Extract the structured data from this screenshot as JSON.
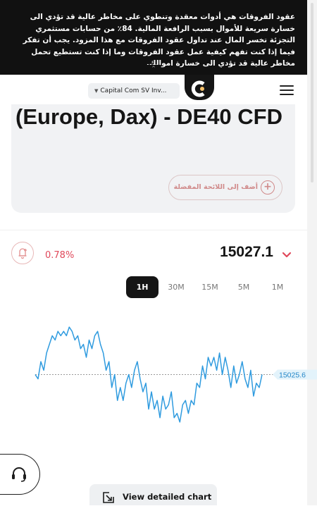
{
  "risk_warning": {
    "text": "عقود الفروقات هي أدوات معقدة وتنطوي على مخاطر عالية قد تؤدي الى خسارة سريعة للأموال بسبب الرافعة المالية. 84٪ من حسابات مستثمري التجزئة تخسر المال عند تداول عقود الفروقات مع هذا المزود. يجب أن تفكر فيما إذا كنت تفهم كيفية عمل عقود الفروقات وما إذا كنت تستطيع تحمل مخاطر عالية قد تؤدي الى خسارة اموالك.",
    "collapse_icon": "double-chevron-up-icon"
  },
  "header": {
    "broker_selector": "Capital Com SV Inv...",
    "logo_icon": "capital-com-logo",
    "menu_icon": "hamburger-menu-icon"
  },
  "instrument": {
    "title": "(Europe, Dax) - DE40 CFD",
    "favorite_label": "أضف إلى اللائحة المفضلة",
    "favorite_icon": "plus-circle-icon"
  },
  "quote": {
    "change": "0.78%",
    "price": "15027.1",
    "alert_icon": "bell-plus-icon",
    "toggle_icon": "chevron-down-icon"
  },
  "timeframes": [
    {
      "label": "1H",
      "active": true
    },
    {
      "label": "30M",
      "active": false
    },
    {
      "label": "15M",
      "active": false
    },
    {
      "label": "5M",
      "active": false
    },
    {
      "label": "1M",
      "active": false
    }
  ],
  "chart_data": {
    "type": "line",
    "x": [
      0,
      1,
      2,
      3,
      4,
      5,
      6,
      7,
      8,
      9,
      10,
      11,
      12,
      13,
      14,
      15,
      16,
      17,
      18,
      19,
      20,
      21,
      22,
      23,
      24,
      25,
      26,
      27,
      28,
      29,
      30,
      31,
      32,
      33,
      34,
      35,
      36,
      37,
      38,
      39,
      40,
      41,
      42,
      43,
      44,
      45,
      46,
      47,
      48,
      49,
      50,
      51,
      52,
      53,
      54,
      55,
      56,
      57,
      58,
      59,
      60,
      61,
      62,
      63,
      64,
      65,
      66,
      67,
      68,
      69,
      70,
      71,
      72,
      73,
      74,
      75,
      76,
      77,
      78,
      79,
      80
    ],
    "values": [
      15025.6,
      15025.5,
      15025.9,
      15025.7,
      15026.1,
      15026.3,
      15026.5,
      15026.4,
      15026.6,
      15026.5,
      15026.6,
      15026.5,
      15026.7,
      15026.6,
      15026.4,
      15026.5,
      15026.2,
      15026.3,
      15026.0,
      15026.4,
      15026.2,
      15026.5,
      15026.6,
      15026.3,
      15026.1,
      15025.7,
      15025.9,
      15025.3,
      15025.6,
      15025.0,
      15025.3,
      15025.0,
      15025.4,
      15025.6,
      15025.3,
      15025.7,
      15025.9,
      15025.5,
      15025.2,
      15025.4,
      15024.8,
      15025.2,
      15024.8,
      15025.0,
      15024.6,
      15025.1,
      15024.8,
      15024.9,
      15025.2,
      15024.6,
      15024.7,
      15024.5,
      15024.9,
      15025.0,
      15024.7,
      15025.0,
      15024.9,
      15025.4,
      15025.3,
      15025.8,
      15025.5,
      15026.0,
      15025.8,
      15026.0,
      15025.7,
      15026.1,
      15025.6,
      15026.0,
      15025.7,
      15025.3,
      15025.8,
      15025.4,
      15025.6,
      15025.9,
      15025.5,
      15025.3,
      15025.7,
      15025.1,
      15025.4,
      15025.3,
      15025.6
    ],
    "current_value": "15025.6",
    "color": "#2f9bdf"
  },
  "support": {
    "icon": "headset-icon"
  },
  "detail_chart": {
    "label": "View detailed chart",
    "icon": "expand-arrow-icon"
  }
}
